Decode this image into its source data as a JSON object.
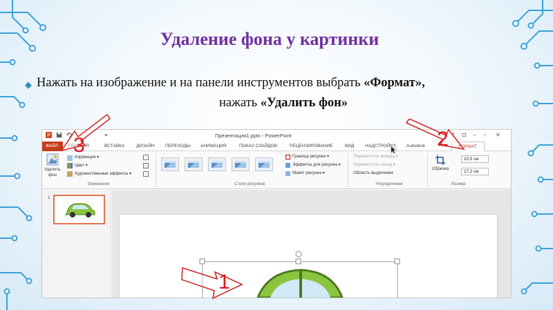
{
  "slide": {
    "title": "Удаление фона у картинки",
    "line1_plain": "Нажать на изображение и  на панели инструментов выбрать ",
    "line1_bold": "«Формат»,",
    "line2_plain": "нажать ",
    "line2_bold": "«Удалить фон»"
  },
  "app": {
    "window_title": "Презентация1.pptx - PowerPoint",
    "tabs": [
      "ФАЙЛ",
      "ГЛАВНАЯ",
      "ВСТАВКА",
      "ДИЗАЙН",
      "ПЕРЕХОДЫ",
      "АНИМАЦИЯ",
      "ПОКАЗ СЛАЙДОВ",
      "РЕЦЕНЗИРОВАНИЕ",
      "ВИД",
      "НАДСТРОЙКИ",
      "Autodesk",
      "ФОРМАТ"
    ],
    "ribbon": {
      "remove_bg_line1": "Удалить",
      "remove_bg_line2": "фон",
      "correction": "Коррекция ▾",
      "color": "Цвет ▾",
      "effects": "Художественные эффекты ▾",
      "group_change": "Изменение",
      "group_styles": "Стили рисунков",
      "border": "Граница рисунка ▾",
      "pic_effects": "Эффекты для рисунка ▾",
      "layout": "Макет рисунка ▾",
      "move_forward": "Переместить вперёд ▾",
      "move_back": "Переместить назад ▾",
      "selection_pane": "Область выделения",
      "group_arrange": "Упорядочение",
      "crop": "Обрезка",
      "height": "10,5 см",
      "width": "17,2 см",
      "group_size": "Размер"
    },
    "thumb_number": "1"
  },
  "callouts": [
    {
      "number": "1"
    },
    {
      "number": "2"
    },
    {
      "number": "3"
    }
  ],
  "colors": {
    "title": "#7030a0",
    "callout_red": "#e0151c",
    "file_tab": "#c43e1c",
    "car_green": "#8bc53f"
  }
}
